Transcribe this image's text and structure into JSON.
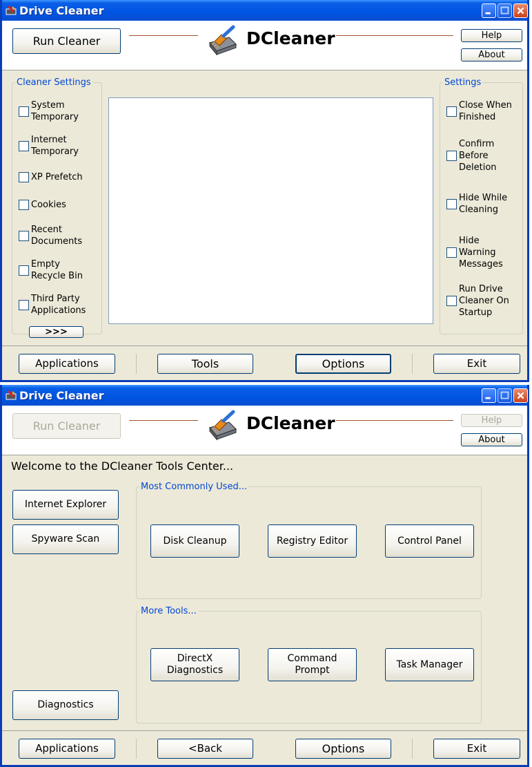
{
  "window1": {
    "title": "Drive Cleaner",
    "header": {
      "run_cleaner": "Run Cleaner",
      "brand": "DCleaner",
      "help": "Help",
      "about": "About"
    },
    "cleaner_settings": {
      "legend": "Cleaner Settings",
      "items": [
        "System\nTemporary",
        "Internet\nTemporary",
        "XP Prefetch",
        "Cookies",
        "Recent\nDocuments",
        "Empty\nRecycle Bin",
        "Third Party\nApplications"
      ],
      "more": ">>>"
    },
    "settings": {
      "legend": "Settings",
      "items": [
        "Close When\nFinished",
        "Confirm\nBefore\nDeletion",
        "Hide While\nCleaning",
        "Hide\nWarning\nMessages",
        "Run Drive\nCleaner On\nStartup"
      ]
    },
    "footer": {
      "applications": "Applications",
      "tools": "Tools",
      "options": "Options",
      "exit": "Exit"
    }
  },
  "window2": {
    "title": "Drive Cleaner",
    "header": {
      "run_cleaner": "Run Cleaner",
      "brand": "DCleaner",
      "help": "Help",
      "about": "About"
    },
    "welcome": "Welcome to the DCleaner Tools Center...",
    "left_buttons": {
      "internet_explorer": "Internet Explorer",
      "spyware_scan": "Spyware Scan",
      "diagnostics": "Diagnostics"
    },
    "most_common": {
      "legend": "Most Commonly Used...",
      "disk_cleanup": "Disk Cleanup",
      "registry_editor": "Registry Editor",
      "control_panel": "Control Panel"
    },
    "more_tools": {
      "legend": "More Tools...",
      "directx": "DirectX\nDiagnostics",
      "command_prompt": "Command\nPrompt",
      "task_manager": "Task Manager"
    },
    "footer": {
      "applications": "Applications",
      "back": "<Back",
      "options": "Options",
      "exit": "Exit"
    }
  },
  "colors": {
    "titlebar": "#0054e3",
    "client": "#ece9d8",
    "legend": "#0046d5",
    "rule": "#a0522d"
  }
}
